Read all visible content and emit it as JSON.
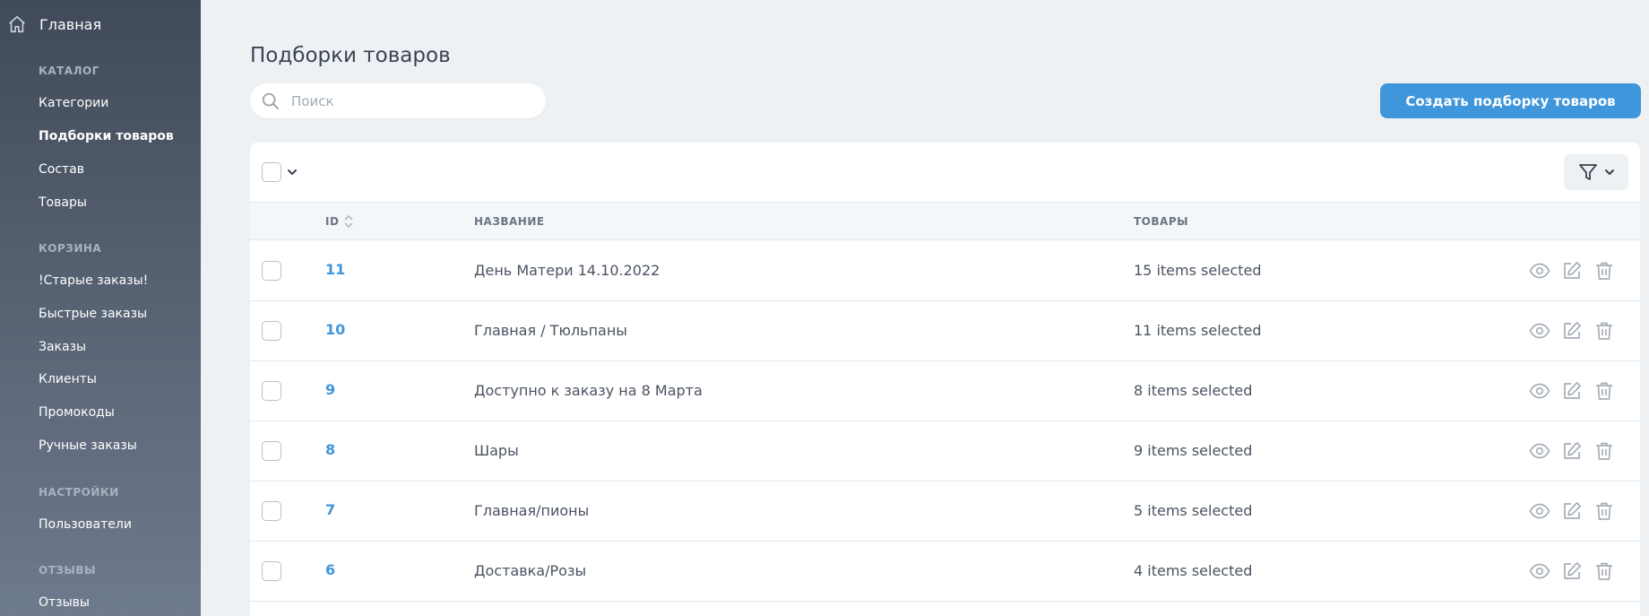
{
  "sidebar": {
    "home_label": "Главная",
    "sections": [
      {
        "title": "КАТАЛОГ",
        "items": [
          "Категории",
          "Подборки товаров",
          "Состав",
          "Товары"
        ]
      },
      {
        "title": "КОРЗИНА",
        "items": [
          "!Старые заказы!",
          "Быстрые заказы",
          "Заказы",
          "Клиенты",
          "Промокоды",
          "Ручные заказы"
        ]
      },
      {
        "title": "НАСТРОЙКИ",
        "items": [
          "Пользователи"
        ]
      },
      {
        "title": "ОТЗЫВЫ",
        "items": [
          "Отзывы"
        ]
      }
    ],
    "active_item": "Подборки товаров"
  },
  "page": {
    "title": "Подборки товаров",
    "search_placeholder": "Поиск",
    "create_button": "Создать подборку товаров"
  },
  "table": {
    "columns": {
      "id": "ID",
      "name": "НАЗВАНИЕ",
      "products": "ТОВАРЫ"
    },
    "rows": [
      {
        "id": "11",
        "name": "День Матери 14.10.2022",
        "products": "15 items selected"
      },
      {
        "id": "10",
        "name": "Главная / Тюльпаны",
        "products": "11 items selected"
      },
      {
        "id": "9",
        "name": "Доступно к заказу на 8 Марта",
        "products": "8 items selected"
      },
      {
        "id": "8",
        "name": "Шары",
        "products": "9 items selected"
      },
      {
        "id": "7",
        "name": "Главная/пионы",
        "products": "5 items selected"
      },
      {
        "id": "6",
        "name": "Доставка/Розы",
        "products": "4 items selected"
      }
    ]
  },
  "colors": {
    "accent": "#3f96db",
    "sidebar_top": "#404a58",
    "sidebar_bottom": "#6e7a8d",
    "background": "#eef1f4"
  },
  "icons": {
    "home": "home-icon",
    "search": "search-icon",
    "filter": "filter-icon",
    "sort": "sort-icon",
    "view": "eye-icon",
    "edit": "edit-icon",
    "delete": "trash-icon"
  }
}
